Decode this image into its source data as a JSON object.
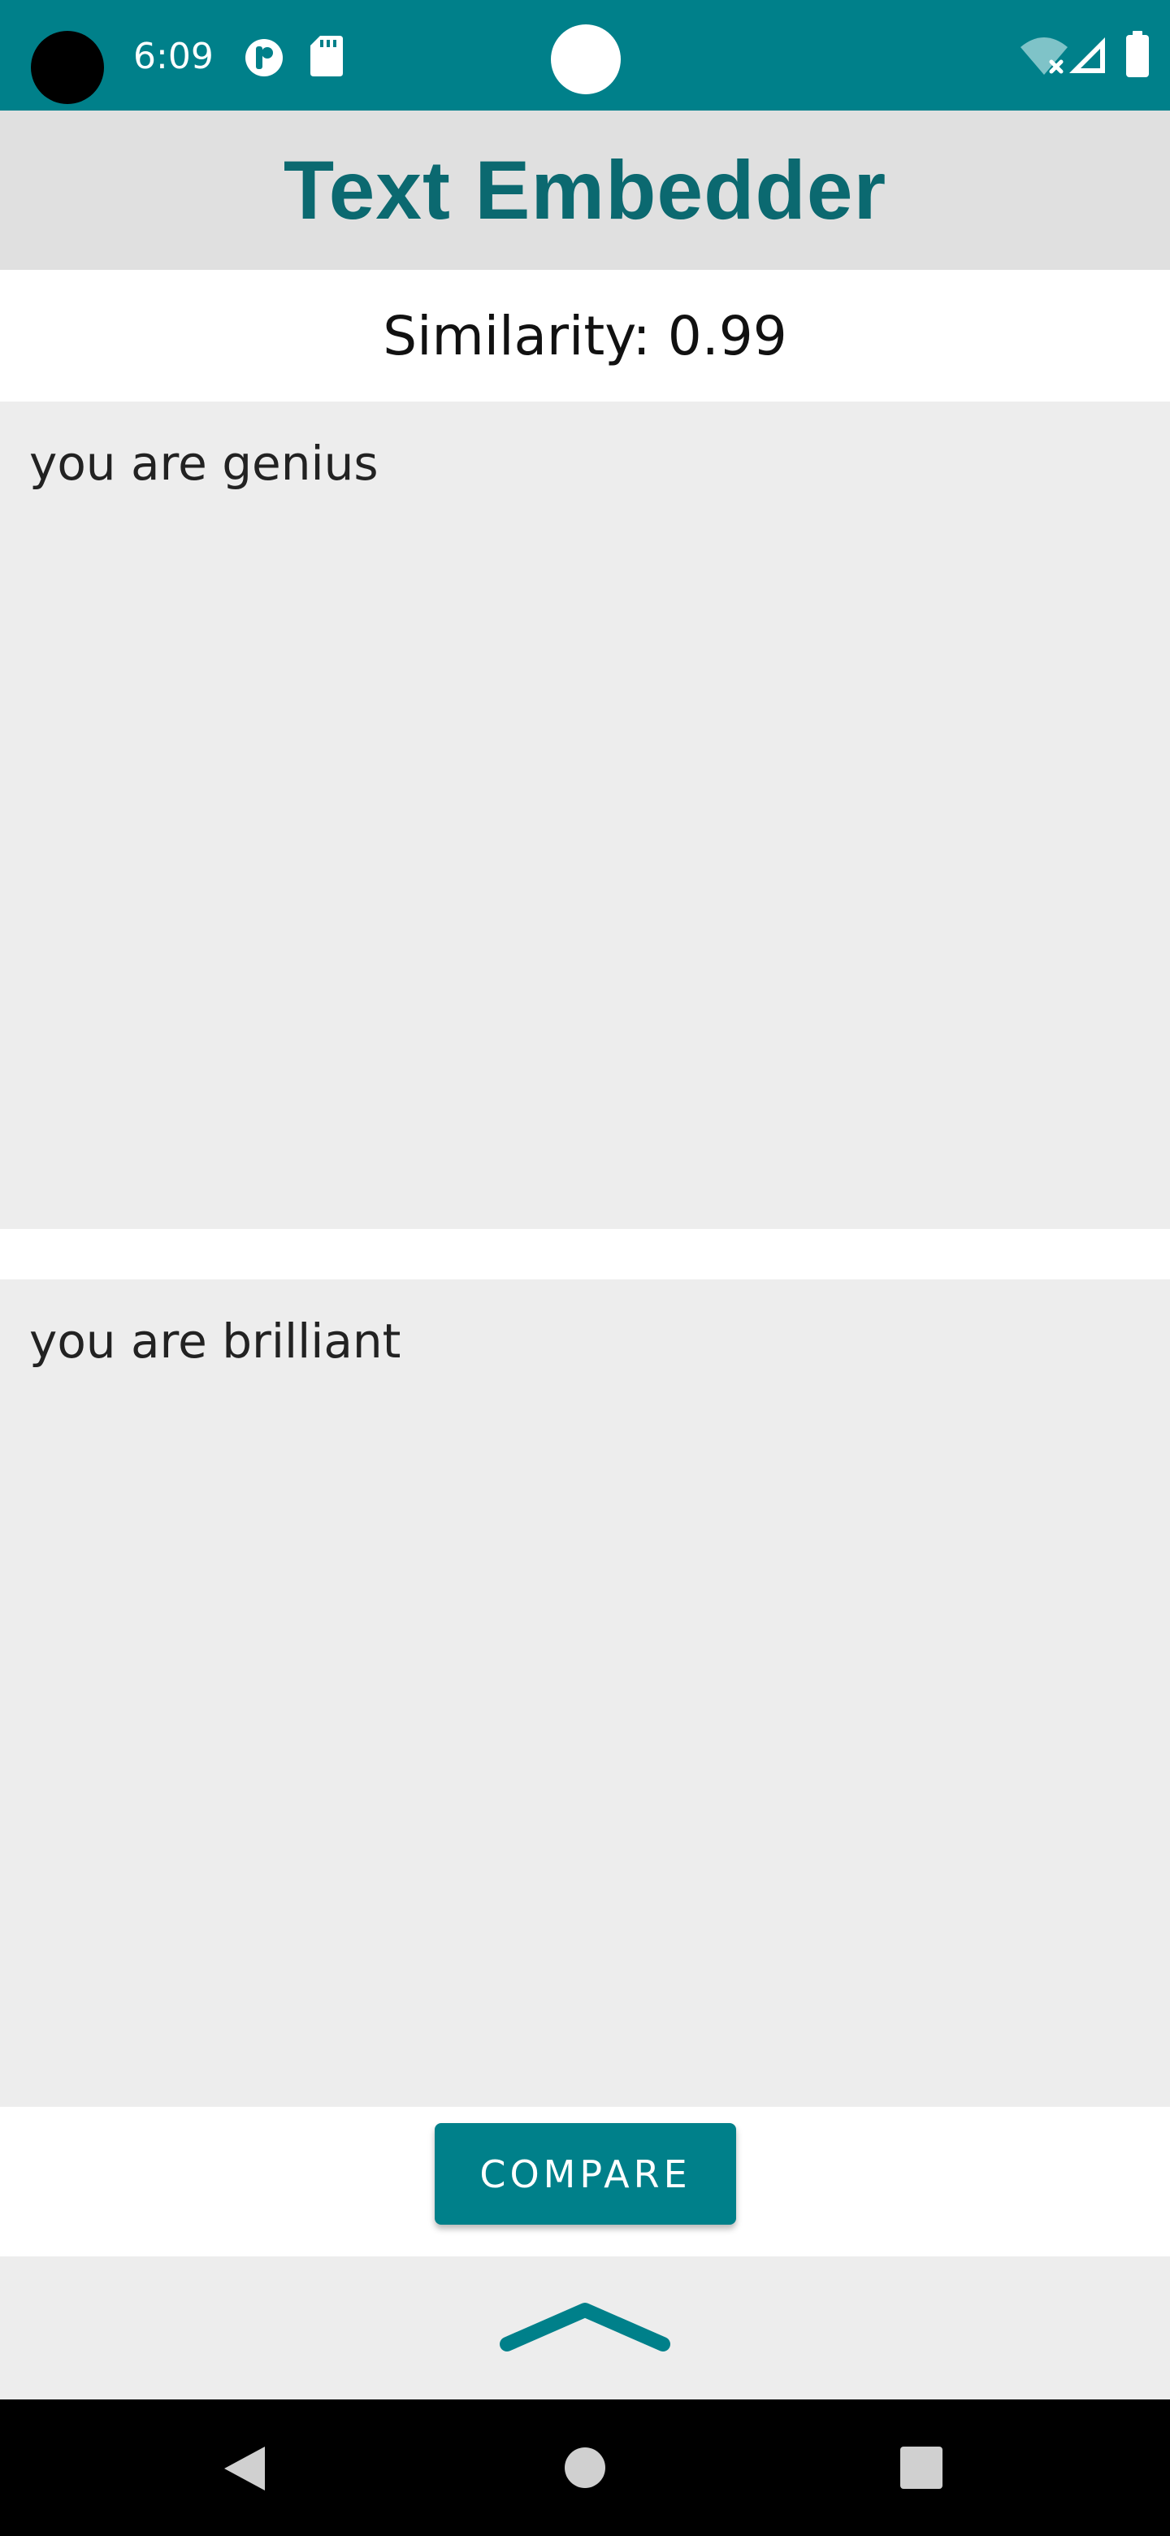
{
  "status_bar": {
    "time": "6:09",
    "icons": [
      "camera-cutout",
      "app-notification-icon",
      "sd-card-icon",
      "wifi-off-icon",
      "signal-icon",
      "battery-icon"
    ],
    "background_color": "#00808a"
  },
  "app_bar": {
    "title": "Text Embedder",
    "title_color": "#0b6970",
    "background_color": "#e0e0e0"
  },
  "result": {
    "similarity_text": "Similarity: 0.99"
  },
  "inputs": {
    "first_text": "you are genius",
    "second_text": "you are brilliant"
  },
  "actions": {
    "compare_label": "COMPARE",
    "accent_color": "#00808a"
  },
  "bottom_sheet": {
    "handle_icon": "chevron-up-icon"
  },
  "nav_bar": {
    "icons": [
      "back-icon",
      "home-icon",
      "recents-icon"
    ]
  }
}
